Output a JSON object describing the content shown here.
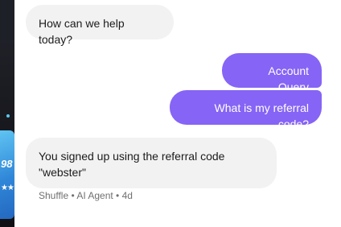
{
  "chat": {
    "messages": [
      {
        "sender": "agent",
        "text": "How can we help today?"
      },
      {
        "sender": "user",
        "text": "Account Query"
      },
      {
        "sender": "user",
        "text": "What is my referral code?"
      },
      {
        "sender": "agent",
        "text": "You signed up using the referral code \"webster\""
      }
    ],
    "last_meta": "Shuffle • AI Agent • 4d"
  },
  "background": {
    "card_number": "98",
    "card_stars": "★★"
  },
  "colors": {
    "user_bubble": "#8664f5",
    "agent_bubble": "#f2f2f2",
    "panel": "#ffffff",
    "meta_text": "#707070"
  }
}
